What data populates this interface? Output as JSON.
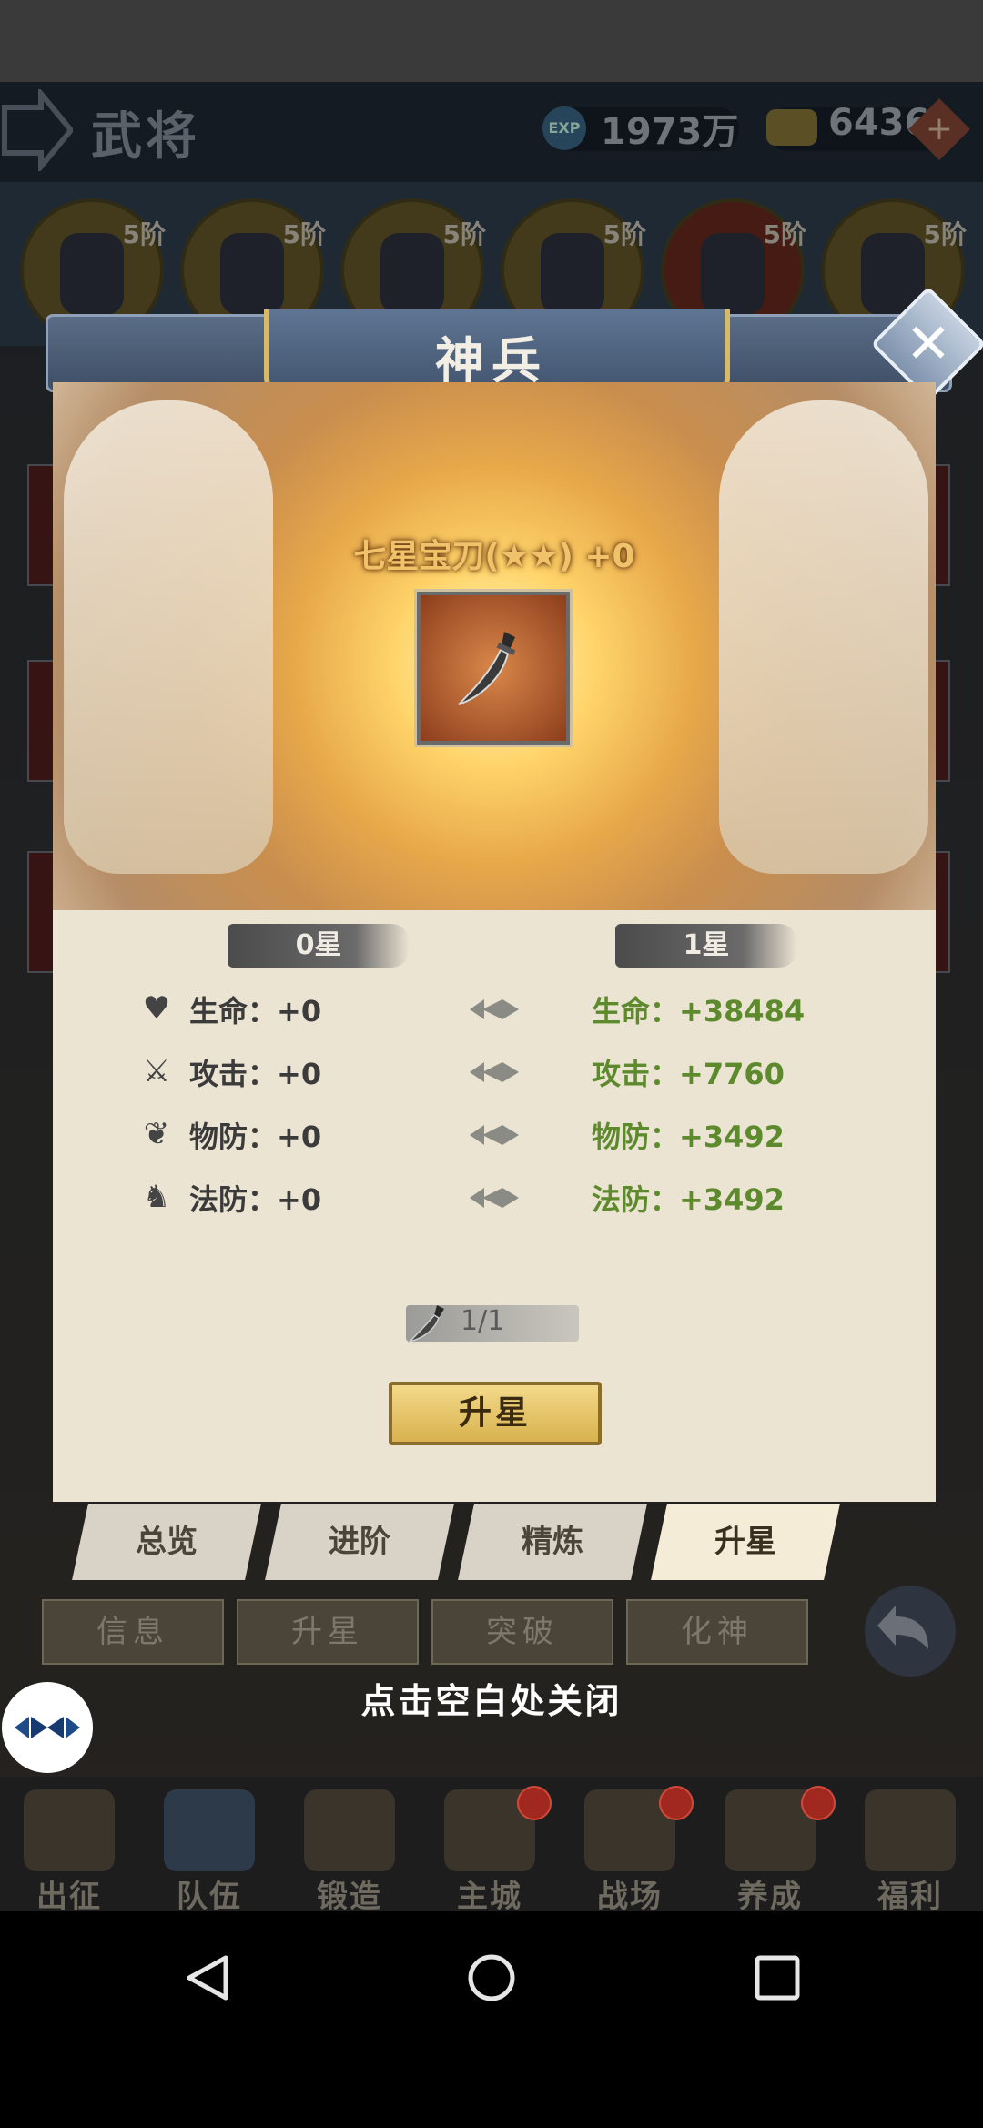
{
  "header": {
    "title": "武将",
    "exp_value": "1973万",
    "exp_icon_text": "EXP",
    "gold_value": "6436",
    "plus": "+"
  },
  "heroes": [
    {
      "rank": "5阶",
      "color": "#665a2a"
    },
    {
      "rank": "5阶",
      "color": "#665a2a"
    },
    {
      "rank": "5阶",
      "color": "#665a2a"
    },
    {
      "rank": "5阶",
      "color": "#665a2a"
    },
    {
      "rank": "5阶",
      "color": "#6a2a20"
    },
    {
      "rank": "5阶",
      "color": "#665a2a"
    }
  ],
  "modal": {
    "title": "神兵",
    "close": "✕",
    "item_name": "七星宝刀(★★) +0",
    "current_star": "0星",
    "next_star": "1星",
    "stats": [
      {
        "icon": "heart-icon",
        "glyph": "♥",
        "label": "生命：",
        "old": "+0",
        "new_label": "生命：",
        "new": "+38484"
      },
      {
        "icon": "crossed-swords-icon",
        "glyph": "⚔",
        "label": "攻击：",
        "old": "+0",
        "new_label": "攻击：",
        "new": "+7760"
      },
      {
        "icon": "paw-icon",
        "glyph": "❦",
        "label": "物防：",
        "old": "+0",
        "new_label": "物防：",
        "new": "+3492"
      },
      {
        "icon": "helmet-icon",
        "glyph": "♞",
        "label": "法防：",
        "old": "+0",
        "new_label": "法防：",
        "new": "+3492"
      }
    ],
    "cost": "1/1",
    "upstar_button": "升星",
    "tabs": [
      "总览",
      "进阶",
      "精炼",
      "升星"
    ],
    "active_tab": 3
  },
  "subtabs": [
    "信息",
    "升星",
    "突破",
    "化神"
  ],
  "close_hint": "点击空白处关闭",
  "bottom_nav": [
    {
      "label": "出征",
      "badge": false
    },
    {
      "label": "队伍",
      "badge": false,
      "active": true
    },
    {
      "label": "锻造",
      "badge": false
    },
    {
      "label": "主城",
      "badge": true
    },
    {
      "label": "战场",
      "badge": true
    },
    {
      "label": "养成",
      "badge": true
    },
    {
      "label": "福利",
      "badge": false
    }
  ],
  "colors": {
    "stat_new": "#5c8a2c",
    "item_name": "#f0c36a",
    "badge": "#a0281e"
  }
}
